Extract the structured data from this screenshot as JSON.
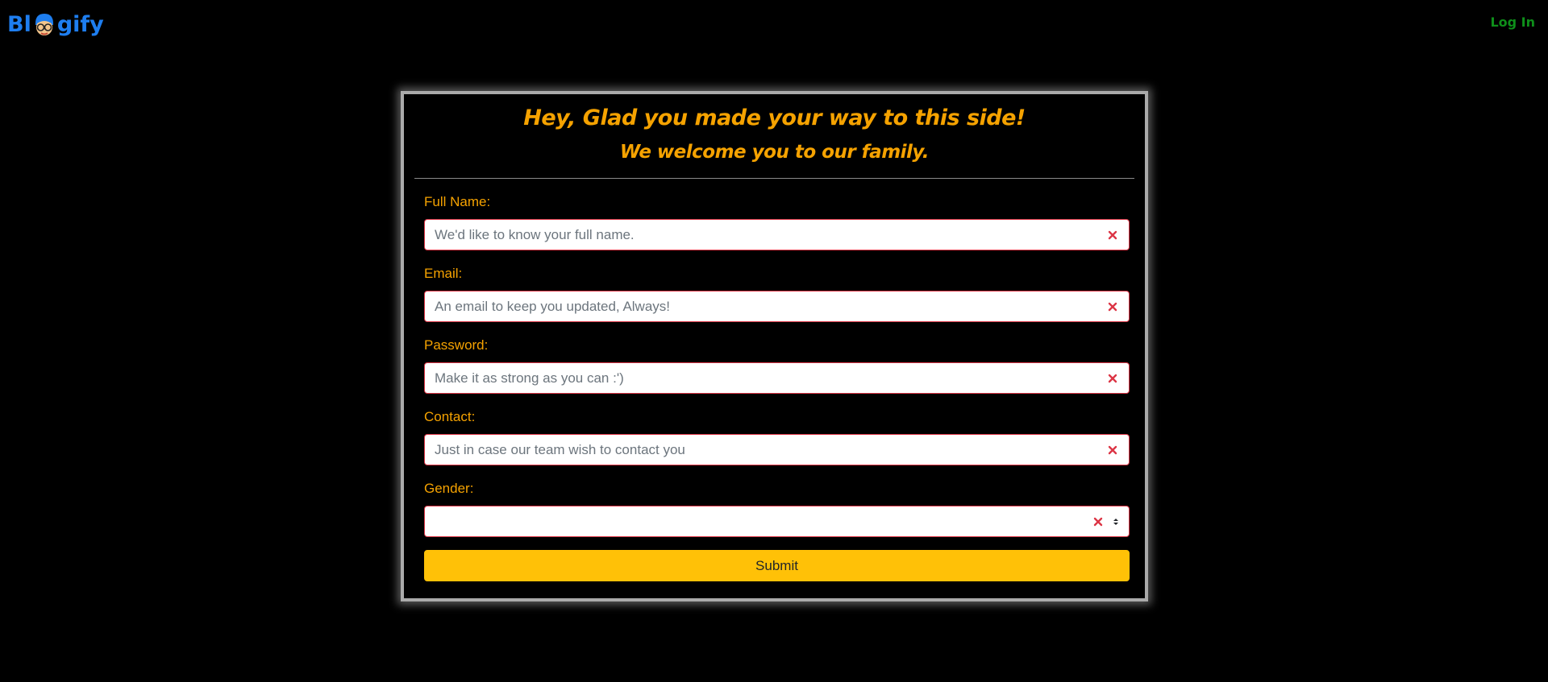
{
  "navbar": {
    "logo_prefix": "Bl",
    "logo_suffix": "gify",
    "logo_icon": "glasses-face-icon",
    "login_label": "Log In",
    "login_color": "#0e8f1a",
    "brand_color": "#1e7ef0"
  },
  "card": {
    "title": "Hey, Glad you made your way to this side!",
    "subtitle": "We welcome you to our family.",
    "accent_color": "#f5a200"
  },
  "form": {
    "fields": [
      {
        "label": "Full Name:",
        "placeholder": "We'd like to know your full name.",
        "value": "",
        "state": "invalid",
        "status_icon": "x-mark-icon"
      },
      {
        "label": "Email:",
        "placeholder": "An email to keep you updated, Always!",
        "value": "",
        "state": "invalid",
        "status_icon": "x-mark-icon"
      },
      {
        "label": "Password:",
        "placeholder": "Make it as strong as you can :')",
        "value": "",
        "state": "invalid",
        "status_icon": "x-mark-icon"
      },
      {
        "label": "Contact:",
        "placeholder": "Just in case our team wish to contact you",
        "value": "",
        "state": "invalid",
        "status_icon": "x-mark-icon"
      }
    ],
    "gender": {
      "label": "Gender:",
      "selected": "",
      "state": "invalid",
      "status_icon": "x-mark-icon"
    },
    "submit_label": "Submit",
    "submit_color": "#ffc107",
    "invalid_color": "#dc3545"
  }
}
